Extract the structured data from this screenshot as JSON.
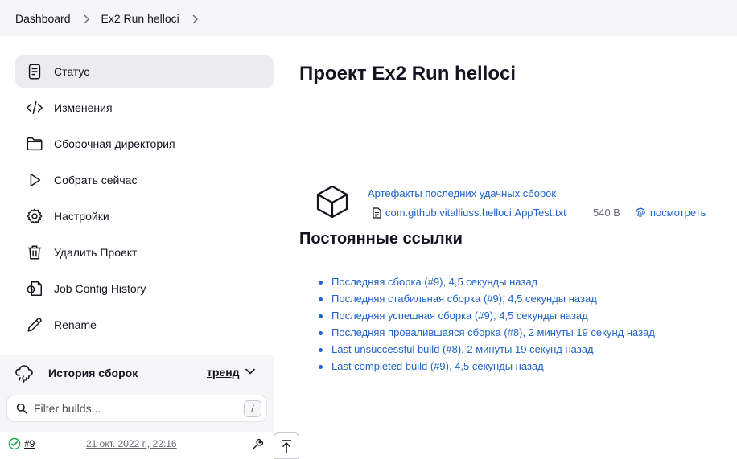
{
  "breadcrumb": {
    "items": [
      "Dashboard",
      "Ex2 Run helloci"
    ]
  },
  "sidebar": {
    "items": [
      {
        "label": "Статус",
        "icon": "document-icon",
        "active": true
      },
      {
        "label": "Изменения",
        "icon": "code-icon"
      },
      {
        "label": "Сборочная директория",
        "icon": "folder-icon"
      },
      {
        "label": "Собрать сейчас",
        "icon": "play-icon"
      },
      {
        "label": "Настройки",
        "icon": "gear-icon"
      },
      {
        "label": "Удалить Проект",
        "icon": "trash-icon"
      },
      {
        "label": "Job Config History",
        "icon": "config-history-icon"
      },
      {
        "label": "Rename",
        "icon": "pencil-icon"
      }
    ]
  },
  "history": {
    "title": "История сборок",
    "trend_label": "тренд",
    "filter_placeholder": "Filter builds...",
    "shortcut": "/",
    "builds": [
      {
        "number": "#9",
        "date": "21 окт. 2022 г., 22:16",
        "status": "success"
      }
    ]
  },
  "main": {
    "title": "Проект Ex2 Run helloci",
    "artifacts": {
      "title": "Артефакты последних удачных сборок",
      "file": "com.github.vitalliuss.helloci.AppTest.txt",
      "size": "540 B",
      "view_label": "посмотреть"
    },
    "permalinks_title": "Постоянные ссылки",
    "permalinks": [
      "Последняя сборка (#9), 4,5 секунды назад",
      "Последняя стабильная сборка (#9), 4,5 секунды назад",
      "Последняя успешная сборка (#9), 4,5 секунды назад",
      "Последняя провалившаяся сборка (#8), 2 минуты 19 секунд назад",
      "Last unsuccessful build (#8), 2 минуты 19 секунд назад",
      "Last completed build (#9), 4,5 секунды назад"
    ]
  },
  "colors": {
    "link": "#1f63c6",
    "success": "#1ea64b",
    "panel_bg": "#f6f6f8",
    "active_bg": "#ececf0"
  }
}
